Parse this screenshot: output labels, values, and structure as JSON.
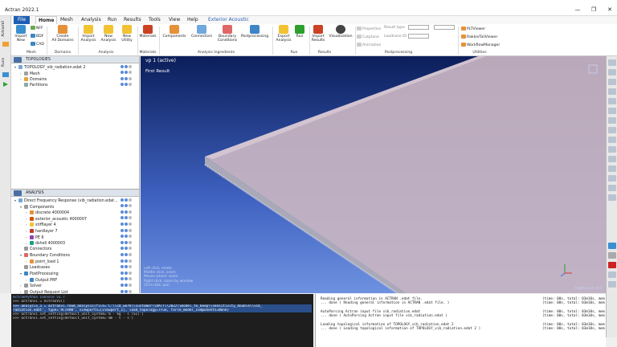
{
  "window": {
    "title": "Actran 2022.1",
    "minimize": "—",
    "maximize": "❐",
    "close": "✕"
  },
  "tabs": {
    "file": "File",
    "items": [
      "Home",
      "Mesh",
      "Analysis",
      "Run",
      "Results",
      "Tools",
      "View",
      "Help",
      "Exterior Acoustic"
    ]
  },
  "ribbon": {
    "import_new": "Import\nNew",
    "nff": "NFF",
    "bdf": "BDF",
    "cad": "CAD",
    "create_domains": "Create\nAll Domains",
    "import_analysis": "Import\nAnalysis",
    "new_analysis": "New\nAnalysis",
    "new_utility": "New\nUtility",
    "materials": "Materials",
    "components": "Components",
    "connectors": "Connectors",
    "boundary": "Boundary\nConditions",
    "postprocessing": "Postprocessing",
    "export_analysis": "Export\nAnalysis",
    "run": "Run",
    "import_results": "Import\nResults",
    "visualization": "Visualization",
    "properties": "Properties",
    "cutplane": "Cutplane",
    "animation": "Animation",
    "result_type": "Result type",
    "loadcase_id": "Loadcase ID",
    "pltviewer": "PLTViewer",
    "rakkieviewer": "RakkieTailViewer",
    "workflowmanager": "WorkflowManager",
    "groups": {
      "mesh": "Mesh",
      "domains": "Domains",
      "analysis": "Analysis",
      "materials": "Materials",
      "ingredients": "Analysis Ingredients",
      "run": "Run",
      "results": "Results",
      "postprocessing": "Postprocessing",
      "utilities": "Utilities"
    }
  },
  "left_vtabs": {
    "actran": "ActranVI",
    "runs": "Runs"
  },
  "topologies": {
    "header": "TOPOLOGIES",
    "items": [
      {
        "label": "TOPOLOGY_vib_radiation.edat 2",
        "level": 0,
        "exp": "▾"
      },
      {
        "label": "Mesh",
        "level": 1,
        "exp": "›"
      },
      {
        "label": "Domains",
        "level": 1,
        "exp": "›"
      },
      {
        "label": "Partitions",
        "level": 1,
        "exp": ""
      }
    ]
  },
  "analysis": {
    "header": "ANALYSIS",
    "items": [
      {
        "label": "Direct Frequency Response (vib_radiation.edat...",
        "level": 0,
        "exp": "▾"
      },
      {
        "label": "Components",
        "level": 1,
        "exp": "▾"
      },
      {
        "label": "discrete 4000004",
        "level": 2,
        "exp": "›"
      },
      {
        "label": "exterior_acoustic 4000007",
        "level": 2,
        "exp": "›"
      },
      {
        "label": "stifflayer 4",
        "level": 2,
        "exp": "›"
      },
      {
        "label": "hardlayer 7",
        "level": 2,
        "exp": "›"
      },
      {
        "label": "PE 6",
        "level": 2,
        "exp": "›"
      },
      {
        "label": "dshell 4000003",
        "level": 2,
        "exp": "›"
      },
      {
        "label": "Connectors",
        "level": 1,
        "exp": ""
      },
      {
        "label": "Boundary Conditions",
        "level": 1,
        "exp": "▾"
      },
      {
        "label": "point_load 1",
        "level": 2,
        "exp": "›"
      },
      {
        "label": "Loadcases",
        "level": 1,
        "exp": ""
      },
      {
        "label": "PostProcessing",
        "level": 1,
        "exp": "▾"
      },
      {
        "label": "Output PRF",
        "level": 2,
        "exp": "›"
      },
      {
        "label": "Solver",
        "level": 1,
        "exp": "›"
      },
      {
        "label": "Output Request List",
        "level": 1,
        "exp": "›"
      }
    ]
  },
  "viewport": {
    "title": "vp 1 (active)",
    "subtitle": "First Result",
    "help": [
      "Left click: rotate",
      "Middle click: zoom",
      "Mouse wheel: zoom",
      "Right click: zoom by window",
      "Ctrl+click: pan"
    ],
    "units": "length unit: mm"
  },
  "console": {
    "lines": [
      "ActranPython Console v3.7",
      ">>> actranvi = ActranVI()",
      ">>> analysis_1 = actranvi.read_analysis(file='C:\\\\cd_work\\\\customer\\\\DATT\\\\2022\\\\model_to_keep\\\\sensitivity_double\\\\vib_",
      "radiation.edat', type='ACTRAN', viewports=[viewport_1], load_topology=True, force_model_components=None)",
      ">>> actranvi.set_setting(default_unit_system='m - kg - s (SI)')",
      ">>> actranvi.set_setting(default_unit_system='mm - t - s')"
    ]
  },
  "output": {
    "lines": [
      {
        "msg": "Reading general information in ACTRAN .edat file.",
        "time": "(time: 00s, total: 03m10s, mem"
      },
      {
        "msg": "  ... done ( Reading general information in ACTRAN .edat file. )",
        "time": "(time: 00s, total: 03m10s, mem"
      },
      {
        "msg": "",
        "time": ""
      },
      {
        "msg": "AutoParsing Actran input file vib_radiation.edat",
        "time": "(time: 00s, total: 03m10s, mem"
      },
      {
        "msg": "  ... done ( AutoParsing Actran input file vib_radiation.edat )",
        "time": "(time: 00s, total: 03m10s, mem"
      },
      {
        "msg": "",
        "time": ""
      },
      {
        "msg": "Loading topological information of TOPOLOGY_vib_radiation.edat 2",
        "time": "(time: 00s, total: 03m10s, mem"
      },
      {
        "msg": "  ... done ( Loading topological information of TOPOLOGY_vib_radiation.edat 2 )",
        "time": "(time: 00s, total: 03m10s, mem"
      }
    ]
  }
}
